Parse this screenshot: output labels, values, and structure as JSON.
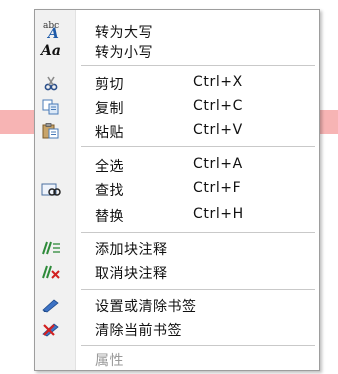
{
  "menu": {
    "items": [
      {
        "label": "转为大写",
        "shortcut": "",
        "icon": "uppercase-abc-icon"
      },
      {
        "label": "转为小写",
        "shortcut": "",
        "icon": "lowercase-aa-icon"
      },
      {
        "label": "剪切",
        "shortcut": "Ctrl+X",
        "icon": "scissors-icon"
      },
      {
        "label": "复制",
        "shortcut": "Ctrl+C",
        "icon": "copy-icon"
      },
      {
        "label": "粘贴",
        "shortcut": "Ctrl+V",
        "icon": "paste-icon"
      },
      {
        "label": "全选",
        "shortcut": "Ctrl+A",
        "icon": ""
      },
      {
        "label": "查找",
        "shortcut": "Ctrl+F",
        "icon": "find-icon"
      },
      {
        "label": "替换",
        "shortcut": "Ctrl+H",
        "icon": ""
      },
      {
        "label": "添加块注释",
        "shortcut": "",
        "icon": "add-block-comment-icon"
      },
      {
        "label": "取消块注释",
        "shortcut": "",
        "icon": "remove-block-comment-icon"
      },
      {
        "label": "设置或清除书签",
        "shortcut": "",
        "icon": "toggle-bookmark-icon"
      },
      {
        "label": "清除当前书签",
        "shortcut": "",
        "icon": "clear-bookmark-icon"
      },
      {
        "label": "属性",
        "shortcut": "",
        "icon": "",
        "disabled": true
      }
    ]
  },
  "colors": {
    "background_band": "#f7b4b4",
    "gutter": "#f1f1f1",
    "border": "#9d9d9d",
    "disabled_text": "#9a9a9a",
    "icon_blue": "#1e5aa8",
    "icon_red": "#d22020",
    "icon_green": "#2e8b3a"
  },
  "icon_glyphs": {
    "abc": "abc",
    "A": "A",
    "Aa": "Aa"
  }
}
